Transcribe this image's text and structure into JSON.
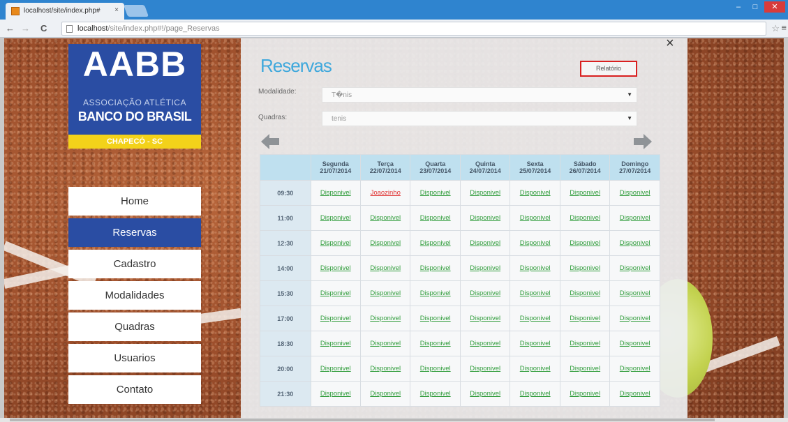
{
  "browser": {
    "tab_title": "localhost/site/index.php#",
    "tab_close": "×",
    "url_host": "localhost",
    "url_path": "/site/index.php#!/page_Reservas",
    "back": "←",
    "forward": "→",
    "reload": "C",
    "star": "☆",
    "menu": "≡",
    "min": "‒",
    "max": "□",
    "close": "✕"
  },
  "logo": {
    "abbr": "AABB",
    "assoc": "ASSOCIAÇÃO ATLÉTICA",
    "bank": "BANCO DO BRASIL",
    "city": "CHAPECÓ - SC"
  },
  "sidebar": {
    "items": [
      "Home",
      "Reservas",
      "Cadastro",
      "Modalidades",
      "Quadras",
      "Usuarios",
      "Contato"
    ]
  },
  "page": {
    "title": "Reservas",
    "report_button": "Relatório",
    "close": "×",
    "modalidade_label": "Modalidade:",
    "modalidade_value": "T�nis",
    "quadras_label": "Quadras:",
    "quadras_value": "tenis",
    "caret": "▼"
  },
  "table": {
    "days": [
      {
        "name": "Segunda",
        "date": "21/07/2014"
      },
      {
        "name": "Terça",
        "date": "22/07/2014"
      },
      {
        "name": "Quarta",
        "date": "23/07/2014"
      },
      {
        "name": "Quinta",
        "date": "24/07/2014"
      },
      {
        "name": "Sexta",
        "date": "25/07/2014"
      },
      {
        "name": "Sábado",
        "date": "26/07/2014"
      },
      {
        "name": "Domingo",
        "date": "27/07/2014"
      }
    ],
    "rows": [
      {
        "time": "09:30",
        "slots": [
          "Disponivel",
          "Joaozinho",
          "Disponivel",
          "Disponivel",
          "Disponivel",
          "Disponivel",
          "Disponivel"
        ]
      },
      {
        "time": "11:00",
        "slots": [
          "Disponivel",
          "Disponivel",
          "Disponivel",
          "Disponivel",
          "Disponivel",
          "Disponivel",
          "Disponivel"
        ]
      },
      {
        "time": "12:30",
        "slots": [
          "Disponivel",
          "Disponivel",
          "Disponivel",
          "Disponivel",
          "Disponivel",
          "Disponivel",
          "Disponivel"
        ]
      },
      {
        "time": "14:00",
        "slots": [
          "Disponivel",
          "Disponivel",
          "Disponivel",
          "Disponivel",
          "Disponivel",
          "Disponivel",
          "Disponivel"
        ]
      },
      {
        "time": "15:30",
        "slots": [
          "Disponivel",
          "Disponivel",
          "Disponivel",
          "Disponivel",
          "Disponivel",
          "Disponivel",
          "Disponivel"
        ]
      },
      {
        "time": "17:00",
        "slots": [
          "Disponivel",
          "Disponivel",
          "Disponivel",
          "Disponivel",
          "Disponivel",
          "Disponivel",
          "Disponivel"
        ]
      },
      {
        "time": "18:30",
        "slots": [
          "Disponivel",
          "Disponivel",
          "Disponivel",
          "Disponivel",
          "Disponivel",
          "Disponivel",
          "Disponivel"
        ]
      },
      {
        "time": "20:00",
        "slots": [
          "Disponivel",
          "Disponivel",
          "Disponivel",
          "Disponivel",
          "Disponivel",
          "Disponivel",
          "Disponivel"
        ]
      },
      {
        "time": "21:30",
        "slots": [
          "Disponivel",
          "Disponivel",
          "Disponivel",
          "Disponivel",
          "Disponivel",
          "Disponivel",
          "Disponivel"
        ]
      }
    ],
    "booked_color": "#e03535",
    "available_color": "#2f9c3a"
  },
  "colors": {
    "brand_blue": "#2a4da3",
    "brand_yellow": "#f3d21a",
    "title_blue": "#3fa8dc",
    "report_border": "#d92020"
  }
}
